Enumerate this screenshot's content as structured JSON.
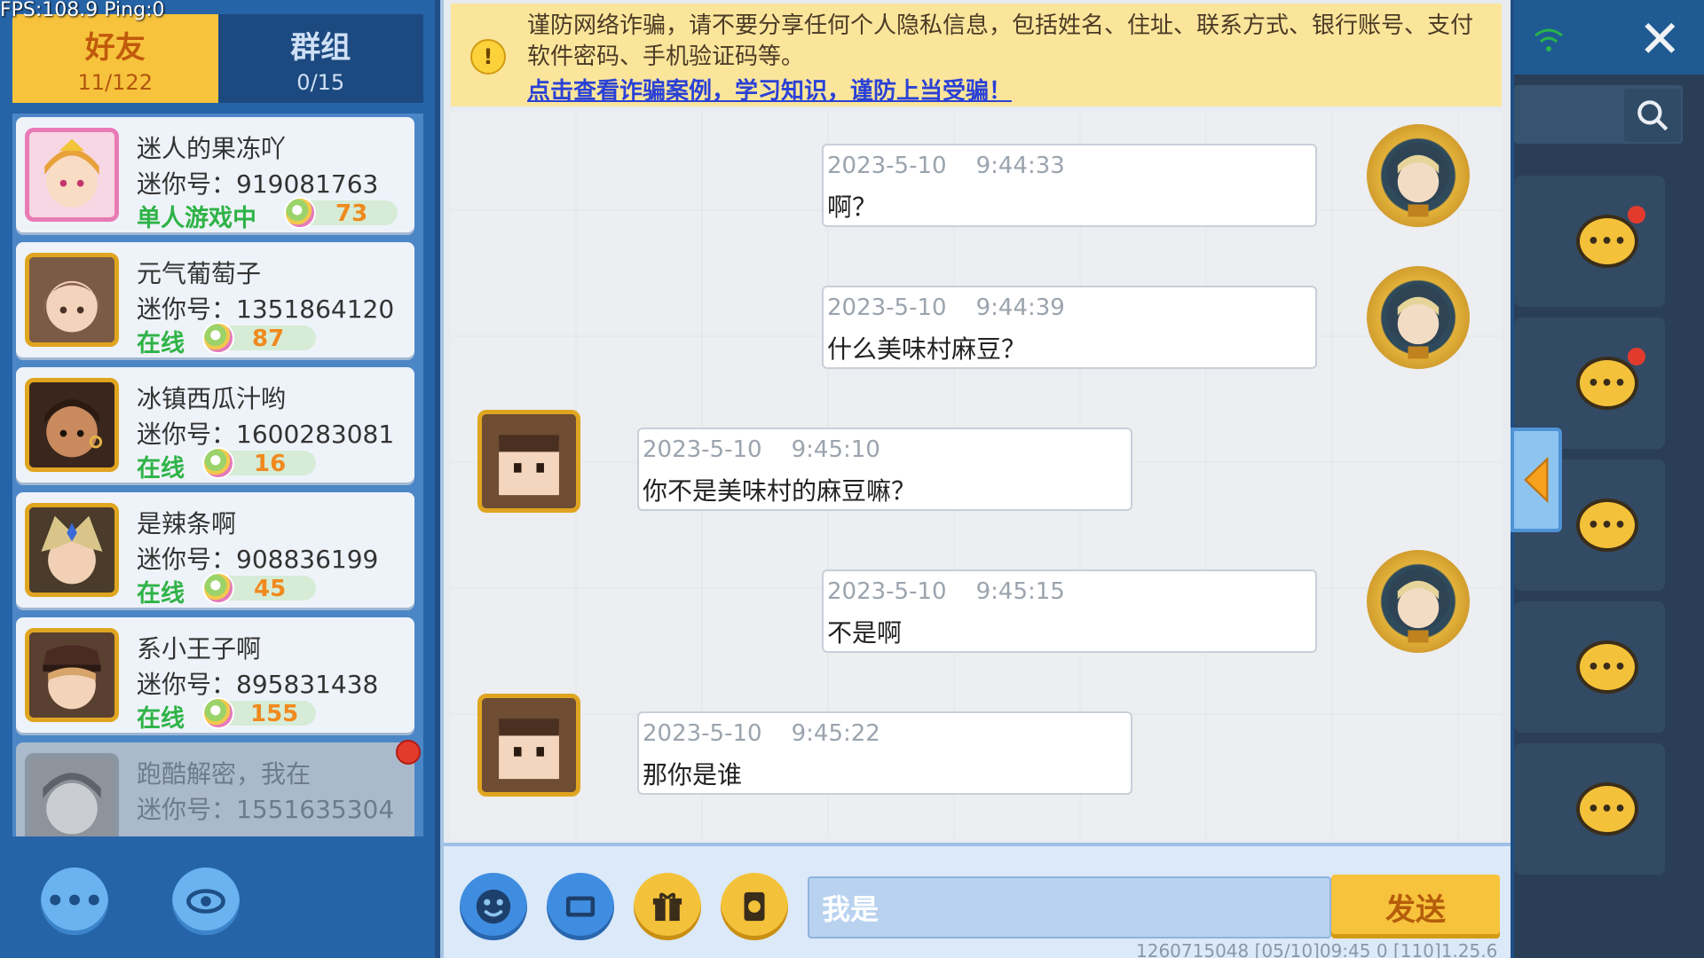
{
  "debug": {
    "fps_text": "FPS:108.9  Ping:0"
  },
  "tabs": [
    {
      "label": "好友",
      "count": "11/122"
    },
    {
      "label": "群组",
      "count": "0/15"
    }
  ],
  "friends": [
    {
      "name": "迷人的果冻吖",
      "id": "迷你号：919081763",
      "status": "单人游戏中",
      "level": "73"
    },
    {
      "name": "元气葡萄子",
      "id": "迷你号：1351864120",
      "status": "在线",
      "level": "87"
    },
    {
      "name": "冰镇西瓜汁哟",
      "id": "迷你号：1600283081",
      "status": "在线",
      "level": "16"
    },
    {
      "name": "是辣条啊",
      "id": "迷你号：908836199",
      "status": "在线",
      "level": "45"
    },
    {
      "name": "系小王子啊",
      "id": "迷你号：895831438",
      "status": "在线",
      "level": "155"
    },
    {
      "name": "跑酷解密，我在",
      "id": "迷你号：1551635304"
    }
  ],
  "left_buttons": {
    "more": "•••"
  },
  "warning": {
    "icon": "!",
    "text": "谨防网络诈骗，请不要分享任何个人隐私信息，包括姓名、住址、联系方式、银行账号、支付软件密码、手机验证码等。",
    "link": "点击查看诈骗案例，学习知识，谨防上当受骗！"
  },
  "messages": [
    {
      "from": "me",
      "time": "2023-5-10    9:44:33",
      "text": "啊？"
    },
    {
      "from": "me",
      "time": "2023-5-10    9:44:39",
      "text": "什么美味村麻豆？"
    },
    {
      "from": "friend",
      "time": "2023-5-10    9:45:10",
      "text": "你不是美味村的麻豆嘛？"
    },
    {
      "from": "me",
      "time": "2023-5-10    9:45:15",
      "text": "不是啊"
    },
    {
      "from": "friend",
      "time": "2023-5-10    9:45:22",
      "text": "那你是谁"
    }
  ],
  "input": {
    "value": "我是",
    "send_label": "发送"
  },
  "footer": {
    "info": "1260715048   [05/10]09:45 0  [110]1.25.6"
  },
  "right_panel": {
    "close": "✕",
    "chat_icon_text": "•••"
  },
  "colors": {
    "accent": "#f7c33c",
    "panel": "#2664a8",
    "online": "#2fb347",
    "link": "#2a41d6"
  }
}
